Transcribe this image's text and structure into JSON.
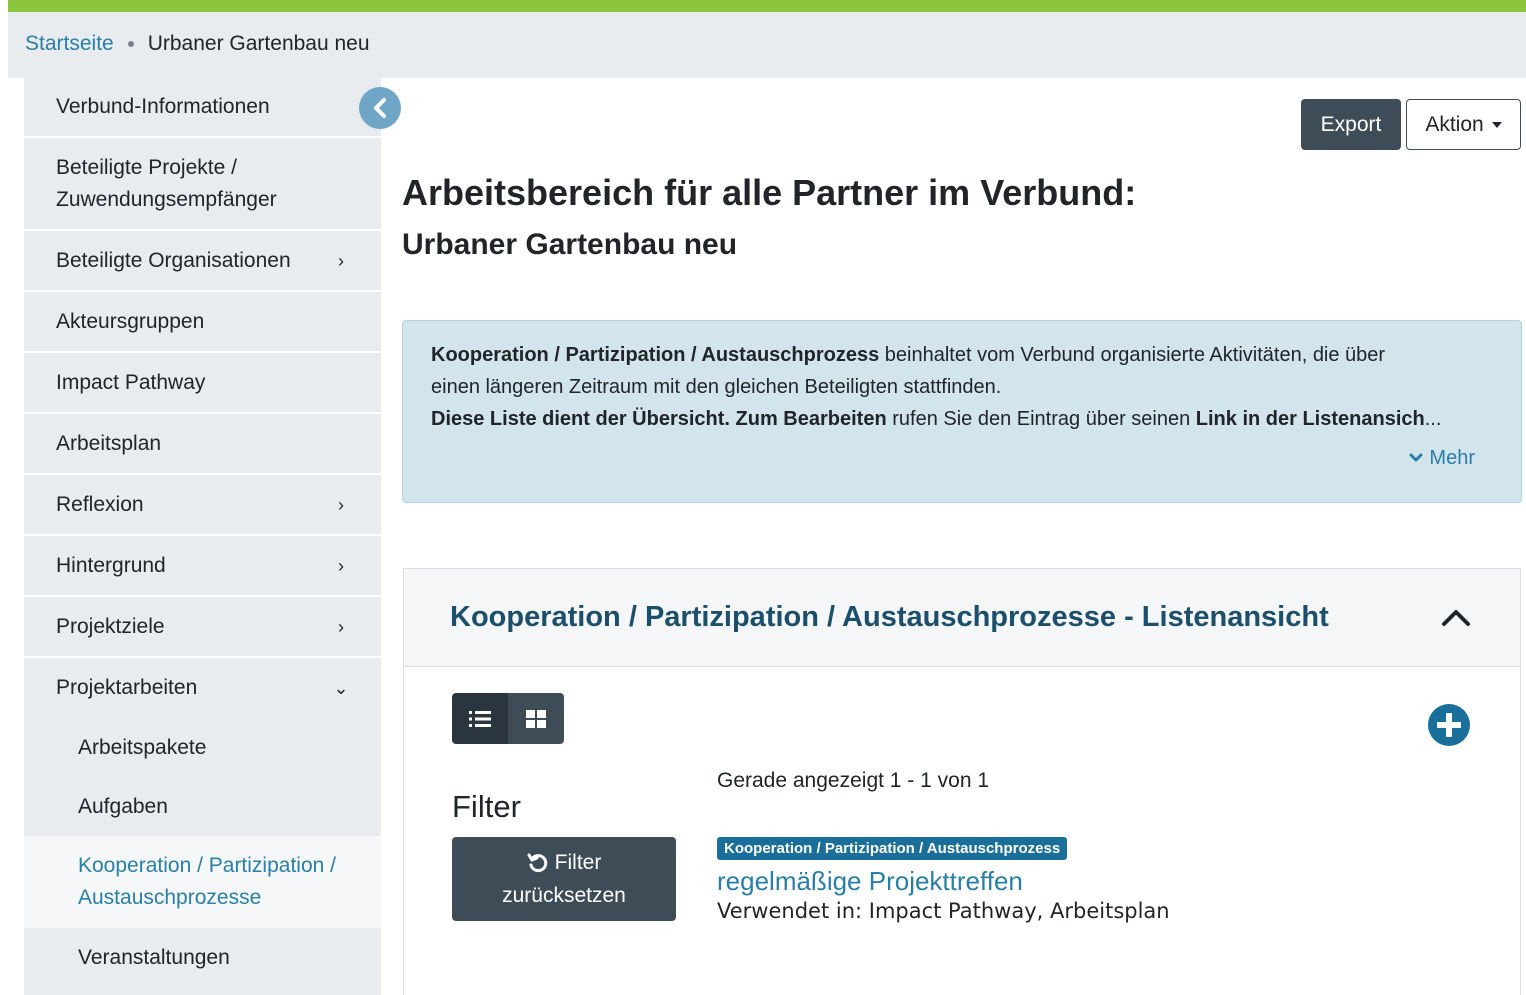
{
  "breadcrumb": {
    "home": "Startseite",
    "current": "Urbaner Gartenbau neu"
  },
  "sidebar": {
    "items": [
      {
        "label": "Verbund-Informationen",
        "chevron": ""
      },
      {
        "label": "Beteiligte Projekte / Zuwendungsempfänger",
        "chevron": ""
      },
      {
        "label": "Beteiligte Organisationen",
        "chevron": "›"
      },
      {
        "label": "Akteursgruppen",
        "chevron": ""
      },
      {
        "label": "Impact Pathway",
        "chevron": ""
      },
      {
        "label": "Arbeitsplan",
        "chevron": ""
      },
      {
        "label": "Reflexion",
        "chevron": "›"
      },
      {
        "label": "Hintergrund",
        "chevron": "›"
      },
      {
        "label": "Projektziele",
        "chevron": "›"
      },
      {
        "label": "Projektarbeiten",
        "chevron": "⌄"
      }
    ],
    "subitems": [
      {
        "label": "Arbeitspakete"
      },
      {
        "label": "Aufgaben"
      },
      {
        "label": "Kooperation / Partizipation / Austauschprozesse",
        "active": true
      },
      {
        "label": "Veranstaltungen"
      }
    ]
  },
  "toolbar": {
    "export_label": "Export",
    "aktion_label": "Aktion"
  },
  "page": {
    "title": "Arbeitsbereich für alle Partner im Verbund:",
    "subtitle": "Urbaner Gartenbau neu"
  },
  "info": {
    "line1_bold": "Kooperation / Partizipation / Austauschprozess",
    "line1_rest": " beinhaltet vom Verbund organisierte Aktivitäten, die über",
    "line2": "einen längeren Zeitraum mit den gleichen Beteiligten stattfinden.",
    "line3_bold1": "Diese Liste dient der Übersicht. Zum Bearbeiten",
    "line3_mid": " rufen Sie den Eintrag über seinen ",
    "line3_bold2": "Link in der Listenansich",
    "line3_end": "...",
    "more_label": "Mehr"
  },
  "list": {
    "title": "Kooperation / Partizipation / Austauschprozesse - Listenansicht",
    "filter_title": "Filter",
    "filter_reset_line1": "Filter",
    "filter_reset_line2": "zurücksetzen",
    "count_text": "Gerade angezeigt 1 - 1 von 1",
    "entries": [
      {
        "badge": "Kooperation / Partizipation / Austauschprozess",
        "title": "regelmäßige Projekttreffen",
        "used_in": "Verwendet in: Impact Pathway, Arbeitsplan"
      }
    ]
  },
  "colors": {
    "accent_green": "#8cc63f",
    "link_blue": "#2a7fa8",
    "dark_button": "#3e4c58",
    "info_bg": "#d2e5ed",
    "badge_bg": "#1a6f9a"
  },
  "icons": {
    "collapse_sidebar": "chevron-left-circle-icon",
    "list_view": "list-icon",
    "grid_view": "grid-icon",
    "add": "plus-circle-icon",
    "reset": "undo-icon",
    "more": "chevron-down-icon",
    "collapse_card": "chevron-up-icon"
  }
}
